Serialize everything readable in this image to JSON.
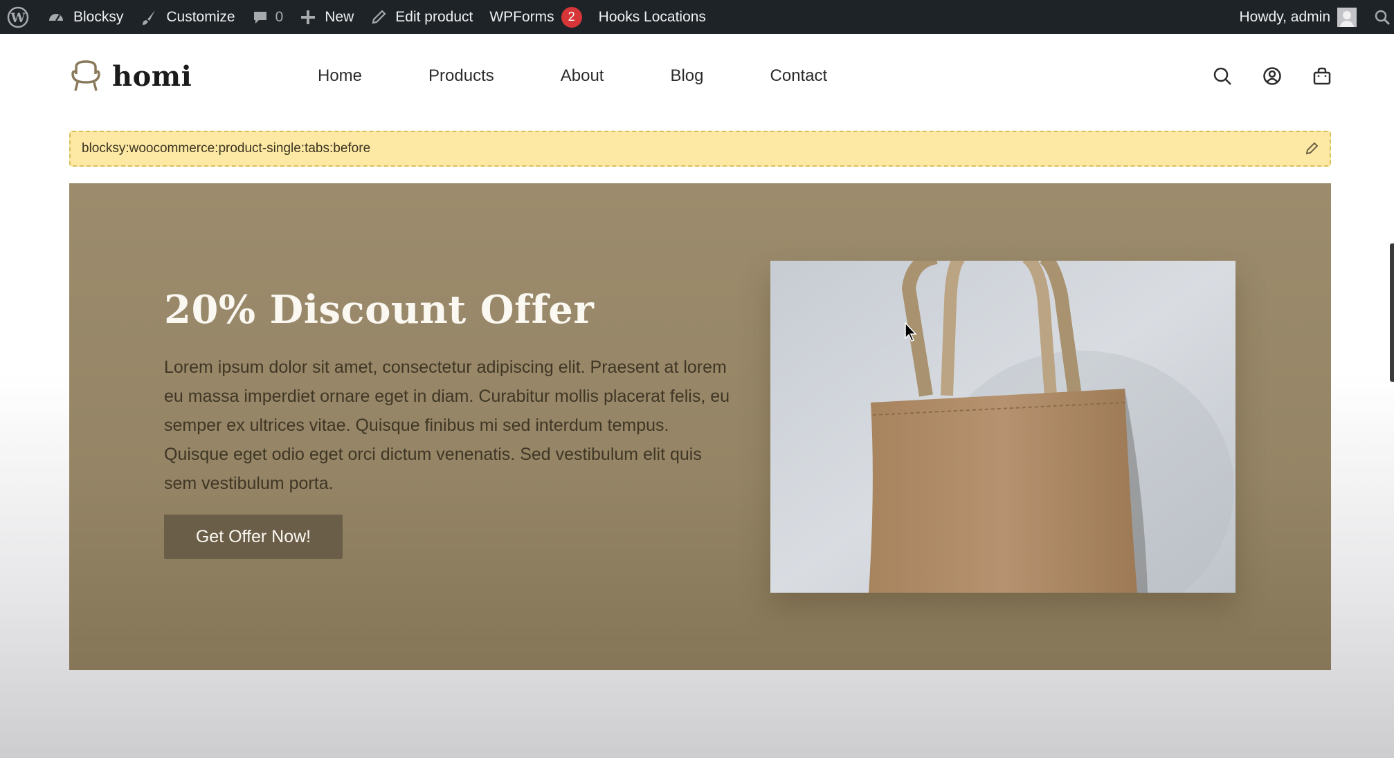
{
  "admin_bar": {
    "site_name": "Blocksy",
    "customize": "Customize",
    "comments_count": "0",
    "new": "New",
    "edit_product": "Edit product",
    "wpforms": "WPForms",
    "wpforms_badge": "2",
    "hooks_locations": "Hooks Locations",
    "howdy": "Howdy, admin"
  },
  "header": {
    "logo_text": "homi",
    "nav": [
      "Home",
      "Products",
      "About",
      "Blog",
      "Contact"
    ],
    "icons": [
      "search-icon",
      "account-icon",
      "cart-icon"
    ]
  },
  "hook_notice": {
    "text": "blocksy:woocommerce:product-single:tabs:before"
  },
  "promo": {
    "title": "20% Discount Offer",
    "body": "Lorem ipsum dolor sit amet, consectetur adipiscing elit. Praesent at lorem eu massa imperdiet ornare eget in diam. Curabitur mollis placerat felis, eu semper ex ultrices vitae. Quisque finibus mi sed interdum tempus. Quisque eget odio eget orci dictum venenatis. Sed vestibulum elit quis sem vestibulum porta.",
    "button": "Get Offer Now!",
    "image": "tote-bag-photo"
  },
  "colors": {
    "admin_bar": "#1d2327",
    "promo_bg": "#9c8c6d",
    "button_bg": "#6b5e49",
    "hook_bg": "#fde9a4",
    "badge": "#d63638"
  }
}
